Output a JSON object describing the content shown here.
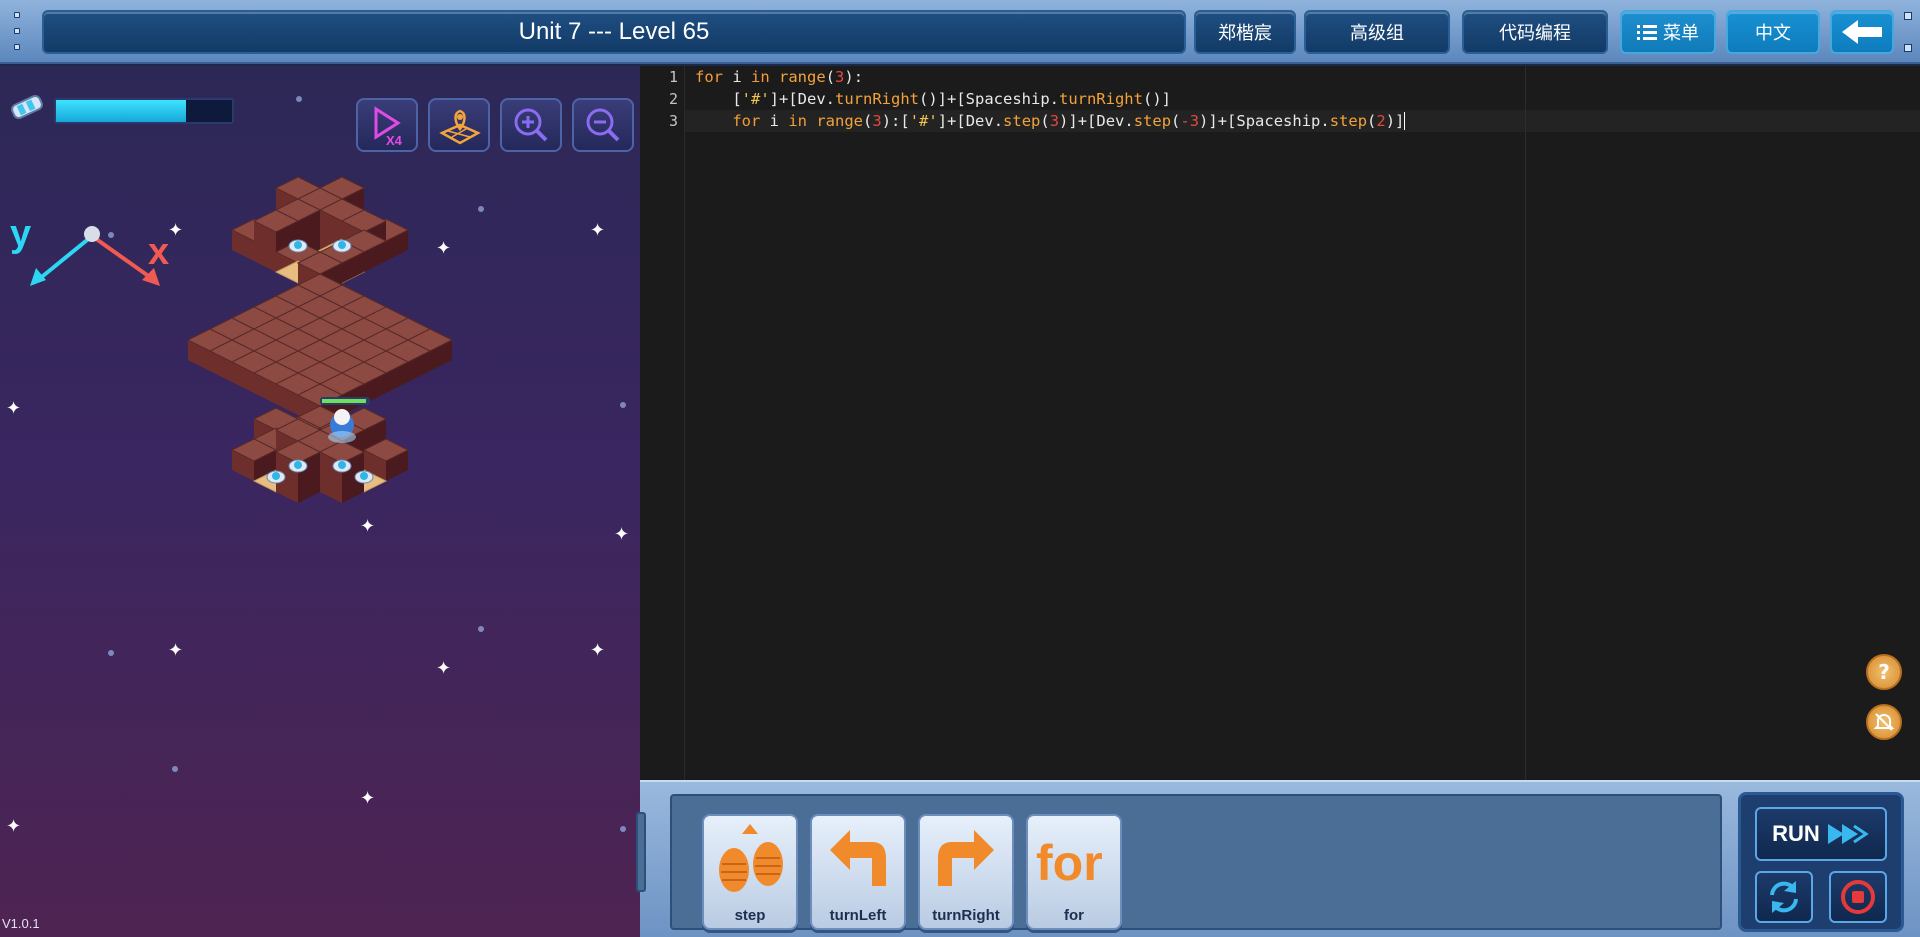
{
  "header": {
    "title": "Unit 7 --- Level 65",
    "user_name": "郑楷宸",
    "group": "高级组",
    "mode": "代码编程",
    "menu_label": "菜单",
    "menu_icon": "list-icon",
    "language": "中文",
    "back_icon": "back-arrow-icon"
  },
  "game": {
    "energy_level": 0.74,
    "speed_label": "X4",
    "axis_y": "y",
    "axis_x": "x",
    "version": "V1.0.1",
    "tools": [
      "speed-icon",
      "map-icon",
      "zoom-in-icon",
      "zoom-out-icon"
    ]
  },
  "editor": {
    "line_numbers": [
      "1",
      "2",
      "3"
    ]
  },
  "blocks": [
    {
      "label": "step",
      "icon": "step-icon"
    },
    {
      "label": "turnLeft",
      "icon": "turn-left-icon"
    },
    {
      "label": "turnRight",
      "icon": "turn-right-icon"
    },
    {
      "label": "for",
      "icon": "for-icon"
    }
  ],
  "controls": {
    "run_label": "RUN",
    "reset_icon": "reset-icon",
    "stop_icon": "stop-icon",
    "help_icon": "help-icon",
    "mute_icon": "mute-icon"
  },
  "colors": {
    "code_keyword": "#f39c36",
    "code_number": "#e04b3c",
    "code_string": "#f0c452",
    "accent": "#1891d3"
  }
}
